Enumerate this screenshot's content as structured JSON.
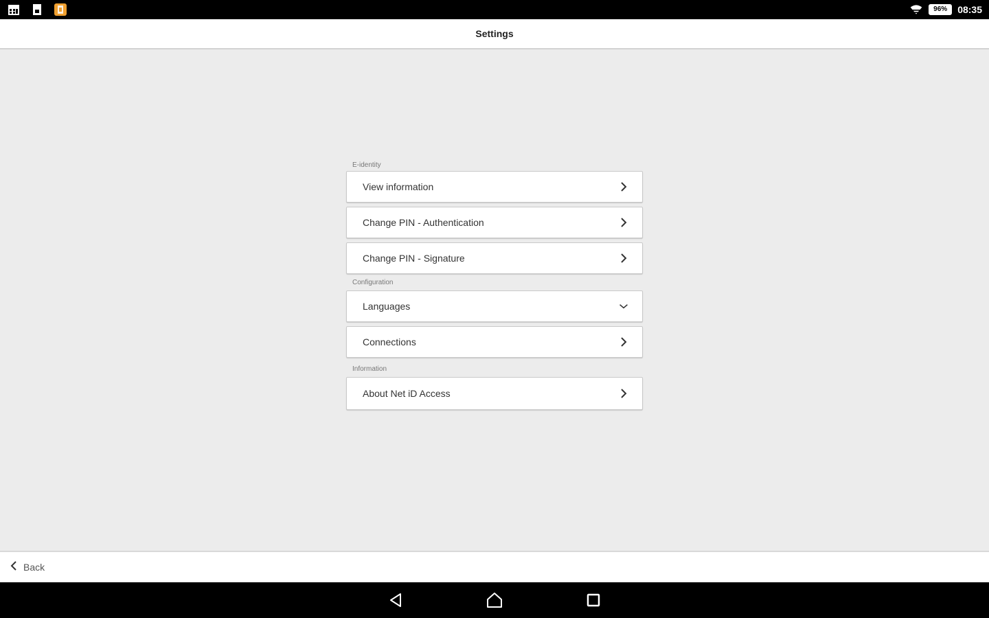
{
  "status_bar": {
    "battery": "96%",
    "time": "08:35",
    "left_icons": [
      "calendar-icon",
      "sim-icon",
      "app-notification-icon"
    ],
    "right_icons": [
      "wifi-icon",
      "battery-icon"
    ]
  },
  "header": {
    "title": "Settings"
  },
  "sections": [
    {
      "label": "E-identity",
      "items": [
        {
          "label": "View information",
          "icon": "chevron-right-icon"
        },
        {
          "label": "Change PIN - Authentication",
          "icon": "chevron-right-icon"
        },
        {
          "label": "Change PIN - Signature",
          "icon": "chevron-right-icon"
        }
      ]
    },
    {
      "label": "Configuration",
      "items": [
        {
          "label": "Languages",
          "icon": "chevron-down-icon"
        },
        {
          "label": "Connections",
          "icon": "chevron-right-icon"
        }
      ]
    },
    {
      "label": "Information",
      "items": [
        {
          "label": "About Net iD Access",
          "icon": "chevron-right-icon"
        }
      ]
    }
  ],
  "bottom_bar": {
    "back_label": "Back"
  },
  "nav_bar": {
    "buttons": [
      "nav-back-icon",
      "nav-home-icon",
      "nav-recents-icon"
    ]
  },
  "colors": {
    "background": "#ececec",
    "card": "#ffffff",
    "status_bar": "#000000",
    "app_icon_accent": "#f0a030"
  }
}
